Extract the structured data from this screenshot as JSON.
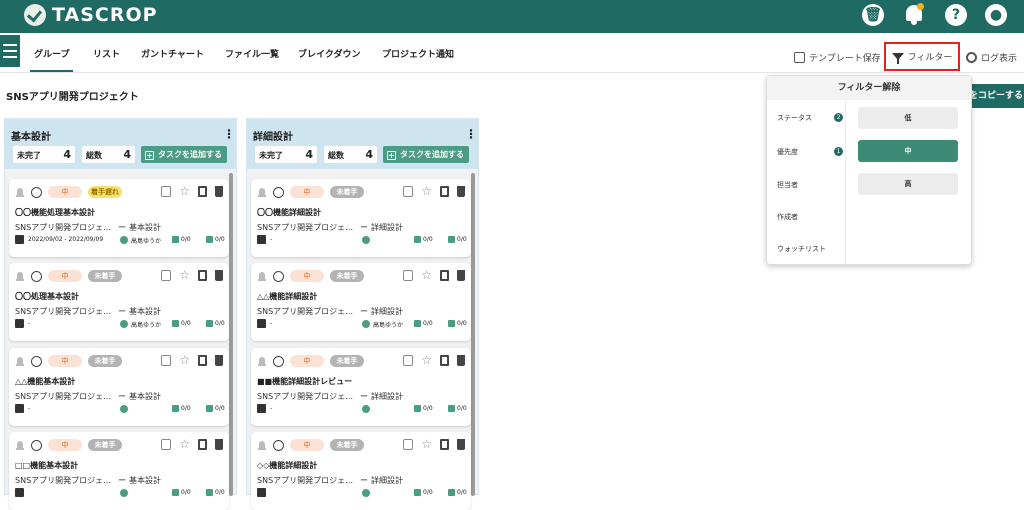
{
  "app": {
    "name": "TASCROP"
  },
  "top_icons": {
    "trash": "trash-icon",
    "notifications": "bell-icon",
    "help_label": "?",
    "profile": "user-icon"
  },
  "tabs": [
    {
      "label": "グループ",
      "active": true
    },
    {
      "label": "リスト"
    },
    {
      "label": "ガントチャート"
    },
    {
      "label": "ファイル一覧"
    },
    {
      "label": "ブレイクダウン"
    },
    {
      "label": "プロジェクト通知"
    }
  ],
  "toolbar": {
    "template_save": "テンプレート保存",
    "filter": "フィルター",
    "log_display": "ログ表示",
    "copy_button": "をコピーする"
  },
  "project_title": "SNSアプリ開発プロジェクト",
  "columns": [
    {
      "title": "基本設計",
      "incomplete_label": "未完了",
      "incomplete_value": "4",
      "total_label": "総数",
      "total_value": "4",
      "add_task": "タスクを追加する",
      "cards": [
        {
          "priority": "中",
          "status": "着手遅れ",
          "name": "〇〇機能処理基本設計",
          "project": "SNSアプリ開発プロジェ…",
          "dash": "ー",
          "category": "基本設計",
          "date": "2022/09/02 - 2022/09/09",
          "assignee": "高島ゆうか",
          "m1": "0/0",
          "m2": "0/0"
        },
        {
          "priority": "中",
          "status": "未着手",
          "name": "〇〇処理基本設計",
          "project": "SNSアプリ開発プロジェ…",
          "dash": "ー",
          "category": "基本設計",
          "date": "-",
          "assignee": "高島ゆうか",
          "m1": "0/0",
          "m2": "0/0"
        },
        {
          "priority": "中",
          "status": "未着手",
          "name": "△△機能基本設計",
          "project": "SNSアプリ開発プロジェ…",
          "dash": "ー",
          "category": "基本設計",
          "date": "-",
          "assignee": "",
          "m1": "0/0",
          "m2": "0/0"
        },
        {
          "priority": "中",
          "status": "未着手",
          "name": "□□機能基本設計",
          "project": "SNSアプリ開発プロジェ…",
          "dash": "ー",
          "category": "基本設計",
          "date": "",
          "assignee": "",
          "m1": "0/0",
          "m2": "0/0"
        }
      ]
    },
    {
      "title": "詳細設計",
      "incomplete_label": "未完了",
      "incomplete_value": "4",
      "total_label": "総数",
      "total_value": "4",
      "add_task": "タスクを追加する",
      "cards": [
        {
          "priority": "中",
          "status": "未着手",
          "name": "〇〇機能詳細設計",
          "project": "SNSアプリ開発プロジェ…",
          "dash": "ー",
          "category": "詳細設計",
          "date": "-",
          "assignee": "",
          "m1": "0/0",
          "m2": "0/0"
        },
        {
          "priority": "中",
          "status": "未着手",
          "name": "△△機能詳細設計",
          "project": "SNSアプリ開発プロジェ…",
          "dash": "ー",
          "category": "詳細設計",
          "date": "-",
          "assignee": "高島ゆうか",
          "m1": "0/0",
          "m2": "0/0"
        },
        {
          "priority": "中",
          "status": "未着手",
          "name": "■■機能詳細設計レビュー",
          "project": "SNSアプリ開発プロジェ…",
          "dash": "ー",
          "category": "詳細設計",
          "date": "-",
          "assignee": "",
          "m1": "0/0",
          "m2": "0/0"
        },
        {
          "priority": "中",
          "status": "未着手",
          "name": "◇◇機能詳細設計",
          "project": "SNSアプリ開発プロジェ…",
          "dash": "ー",
          "category": "詳細設計",
          "date": "",
          "assignee": "",
          "m1": "0/0",
          "m2": "0/0"
        }
      ]
    }
  ],
  "filter_panel": {
    "header": "フィルター解除",
    "categories": [
      {
        "label": "ステータス",
        "count": "2"
      },
      {
        "label": "優先度",
        "count": "1"
      },
      {
        "label": "担当者"
      },
      {
        "label": "作成者"
      },
      {
        "label": "ウォッチリスト"
      }
    ],
    "options": [
      {
        "label": "低",
        "selected": false
      },
      {
        "label": "中",
        "selected": true
      },
      {
        "label": "高",
        "selected": false
      }
    ]
  },
  "colors": {
    "brand": "#1f6b63",
    "accent": "#4a9d84",
    "highlight_border": "#e2231a"
  }
}
